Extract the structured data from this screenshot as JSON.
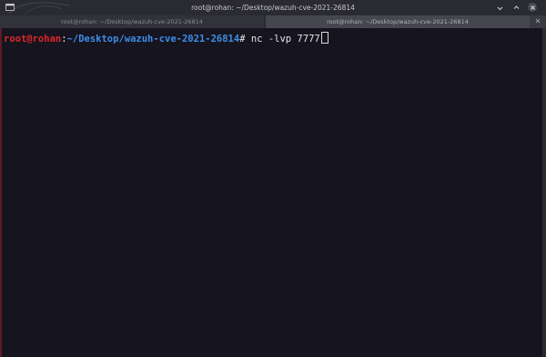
{
  "window": {
    "title": "root@rohan: ~/Desktop/wazuh-cve-2021-26814",
    "controls": {
      "minimize_icon": "minimize-icon",
      "maximize_icon": "maximize-icon",
      "close_icon": "close-icon"
    }
  },
  "tabs": [
    {
      "label": "root@rohan: ~/Desktop/wazuh-cve-2021-26814"
    },
    {
      "label": "root@rohan: ~/Desktop/wazuh-cve-2021-26814"
    }
  ],
  "terminal": {
    "prompt_user": "root@rohan",
    "prompt_sep": ":",
    "prompt_path": "~/Desktop/wazuh-cve-2021-26814",
    "prompt_symbol": "#",
    "command": " nc -lvp 7777"
  },
  "colors": {
    "background": "#16141f",
    "prompt_user": "#e0262a",
    "prompt_path": "#3d8ee8"
  }
}
